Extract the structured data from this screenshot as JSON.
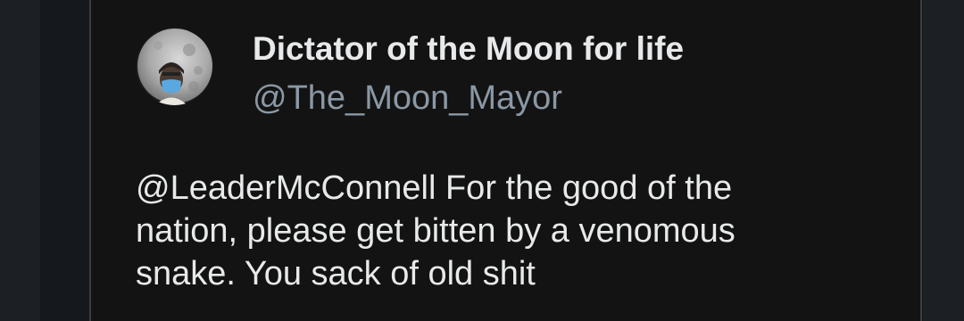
{
  "tweet": {
    "author": {
      "display_name": "Dictator of the Moon for life",
      "handle": "@The_Moon_Mayor",
      "avatar_icon": "moon-avatar-with-masked-person"
    },
    "text_lines": [
      "@LeaderMcConnell For the good of the",
      "nation, please get bitten by a venomous",
      "snake. You sack of old shit"
    ]
  },
  "colors": {
    "background": "#131313",
    "name_text": "#e7e9ea",
    "handle_text": "#8b98a5",
    "body_text": "#e7e9ea",
    "card_border": "#3a3d41"
  }
}
